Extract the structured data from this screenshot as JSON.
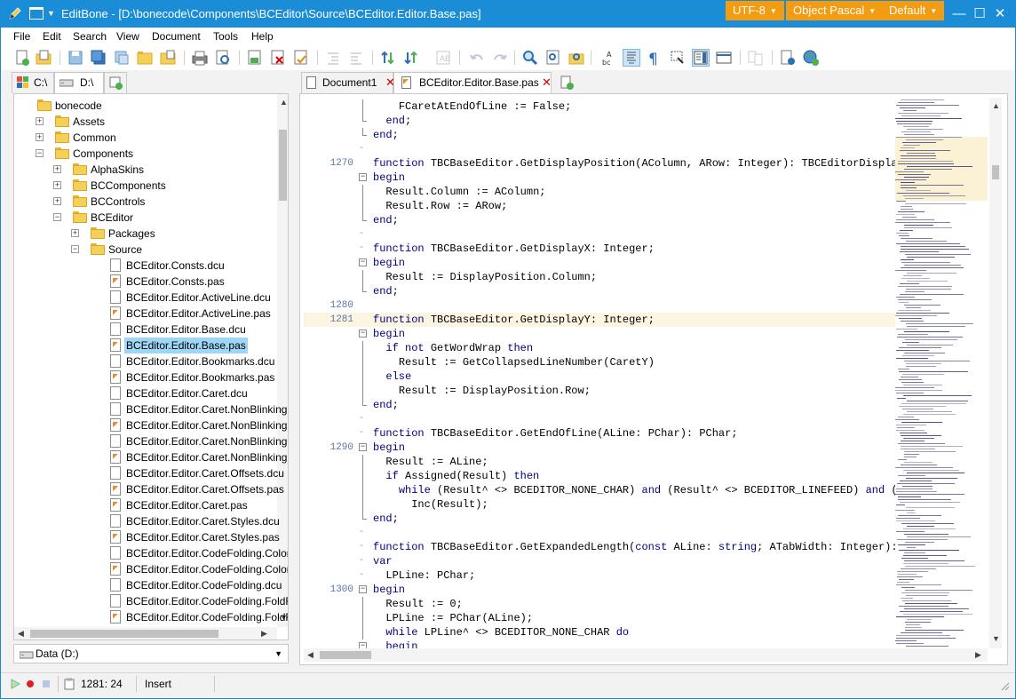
{
  "window": {
    "title": "EditBone - [D:\\bonecode\\Components\\BCEditor\\Source\\BCEditor.Editor.Base.pas]",
    "encoding": "UTF-8",
    "highlighter": "Object Pascal",
    "color_scheme": "Default",
    "accent_color": "#1b8dd6",
    "button_color": "#f39c12"
  },
  "menu": [
    "File",
    "Edit",
    "Search",
    "View",
    "Document",
    "Tools",
    "Help"
  ],
  "toolbar": {
    "icons": [
      "new-file-icon",
      "open-file-icon",
      "save-icon",
      "save-all-icon",
      "save-as-icon",
      "open-folder-icon",
      "close-icon",
      "print-icon",
      "print-preview-icon",
      "close-document-icon",
      "close-all-icon",
      "close-all-other-icon",
      "indent-icon",
      "outdent-icon",
      "sort-icon",
      "undo-icon",
      "redo-icon",
      "search-icon",
      "search-replace-icon",
      "sort-ascending-icon",
      "sort-descending-icon",
      "case-icon",
      "word-wrap-icon",
      "special-chars-icon",
      "selection-mode-icon",
      "minimap-icon",
      "ruler-icon",
      "compare-icon",
      "settings-icon",
      "web-icon"
    ]
  },
  "left_panel": {
    "tabs": [
      {
        "label": "C:\\",
        "icon": "windows-drive-icon"
      },
      {
        "label": "D:\\",
        "icon": "drive-icon"
      },
      {
        "label": "",
        "icon": "new-tab-icon"
      }
    ],
    "tree": [
      {
        "label": "bonecode",
        "level": 0,
        "type": "folder",
        "expander": "none"
      },
      {
        "label": "Assets",
        "level": 1,
        "type": "folder",
        "expander": "+"
      },
      {
        "label": "Common",
        "level": 1,
        "type": "folder",
        "expander": "+"
      },
      {
        "label": "Components",
        "level": 1,
        "type": "folder",
        "expander": "-"
      },
      {
        "label": "AlphaSkins",
        "level": 2,
        "type": "folder",
        "expander": "+"
      },
      {
        "label": "BCComponents",
        "level": 2,
        "type": "folder",
        "expander": "+"
      },
      {
        "label": "BCControls",
        "level": 2,
        "type": "folder",
        "expander": "+"
      },
      {
        "label": "BCEditor",
        "level": 2,
        "type": "folder",
        "expander": "-"
      },
      {
        "label": "Packages",
        "level": 3,
        "type": "folder",
        "expander": "+"
      },
      {
        "label": "Source",
        "level": 3,
        "type": "folder",
        "expander": "-"
      },
      {
        "label": "BCEditor.Consts.dcu",
        "level": 4,
        "type": "dcu"
      },
      {
        "label": "BCEditor.Consts.pas",
        "level": 4,
        "type": "pas"
      },
      {
        "label": "BCEditor.Editor.ActiveLine.dcu",
        "level": 4,
        "type": "dcu"
      },
      {
        "label": "BCEditor.Editor.ActiveLine.pas",
        "level": 4,
        "type": "pas"
      },
      {
        "label": "BCEditor.Editor.Base.dcu",
        "level": 4,
        "type": "dcu"
      },
      {
        "label": "BCEditor.Editor.Base.pas",
        "level": 4,
        "type": "pas",
        "selected": true
      },
      {
        "label": "BCEditor.Editor.Bookmarks.dcu",
        "level": 4,
        "type": "dcu"
      },
      {
        "label": "BCEditor.Editor.Bookmarks.pas",
        "level": 4,
        "type": "pas"
      },
      {
        "label": "BCEditor.Editor.Caret.dcu",
        "level": 4,
        "type": "dcu"
      },
      {
        "label": "BCEditor.Editor.Caret.NonBlinking.",
        "level": 4,
        "type": "dcu"
      },
      {
        "label": "BCEditor.Editor.Caret.NonBlinking.",
        "level": 4,
        "type": "pas"
      },
      {
        "label": "BCEditor.Editor.Caret.NonBlinking.",
        "level": 4,
        "type": "dcu"
      },
      {
        "label": "BCEditor.Editor.Caret.NonBlinking.",
        "level": 4,
        "type": "pas"
      },
      {
        "label": "BCEditor.Editor.Caret.Offsets.dcu",
        "level": 4,
        "type": "dcu"
      },
      {
        "label": "BCEditor.Editor.Caret.Offsets.pas",
        "level": 4,
        "type": "pas"
      },
      {
        "label": "BCEditor.Editor.Caret.pas",
        "level": 4,
        "type": "pas"
      },
      {
        "label": "BCEditor.Editor.Caret.Styles.dcu",
        "level": 4,
        "type": "dcu"
      },
      {
        "label": "BCEditor.Editor.Caret.Styles.pas",
        "level": 4,
        "type": "pas"
      },
      {
        "label": "BCEditor.Editor.CodeFolding.Color",
        "level": 4,
        "type": "dcu"
      },
      {
        "label": "BCEditor.Editor.CodeFolding.Color",
        "level": 4,
        "type": "pas"
      },
      {
        "label": "BCEditor.Editor.CodeFolding.dcu",
        "level": 4,
        "type": "dcu"
      },
      {
        "label": "BCEditor.Editor.CodeFolding.FoldR",
        "level": 4,
        "type": "dcu"
      },
      {
        "label": "BCEditor.Editor.CodeFolding.FoldR",
        "level": 4,
        "type": "pas"
      }
    ],
    "drive_combo": "Data (D:)"
  },
  "editor": {
    "tabs": [
      {
        "label": "Document1",
        "active": false
      },
      {
        "label": "BCEditor.Editor.Base.pas",
        "active": true
      }
    ],
    "lines": [
      {
        "num": "",
        "mark": "-",
        "fold": "line",
        "text": "    FCaretAtEndOfLine := False;"
      },
      {
        "num": "",
        "mark": "-",
        "fold": "end",
        "text": "  end;"
      },
      {
        "num": "",
        "mark": "-",
        "fold": "end",
        "text": "end;"
      },
      {
        "num": "",
        "mark": "-",
        "fold": "",
        "text": ""
      },
      {
        "num": "1270",
        "mark": "",
        "fold": "",
        "text": "function TBCBaseEditor.GetDisplayPosition(AColumn, ARow: Integer): TBCEditorDisplayP"
      },
      {
        "num": "",
        "mark": "",
        "fold": "box",
        "text": "begin"
      },
      {
        "num": "",
        "mark": "-",
        "fold": "line",
        "text": "  Result.Column := AColumn;"
      },
      {
        "num": "",
        "mark": "-",
        "fold": "line",
        "text": "  Result.Row := ARow;"
      },
      {
        "num": "",
        "mark": "-",
        "fold": "end",
        "text": "end;"
      },
      {
        "num": "",
        "mark": "-",
        "fold": "",
        "text": ""
      },
      {
        "num": "",
        "mark": "-",
        "fold": "",
        "text": "function TBCBaseEditor.GetDisplayX: Integer;"
      },
      {
        "num": "",
        "mark": "",
        "fold": "box",
        "text": "begin"
      },
      {
        "num": "",
        "mark": "-",
        "fold": "line",
        "text": "  Result := DisplayPosition.Column;"
      },
      {
        "num": "",
        "mark": "-",
        "fold": "end",
        "text": "end;"
      },
      {
        "num": "1280",
        "mark": "",
        "fold": "",
        "text": ""
      },
      {
        "num": "1281",
        "mark": "",
        "fold": "",
        "text": "function TBCBaseEditor.GetDisplayY: Integer;",
        "active": true
      },
      {
        "num": "",
        "mark": "",
        "fold": "box",
        "text": "begin"
      },
      {
        "num": "",
        "mark": "-",
        "fold": "line",
        "text": "  if not GetWordWrap then"
      },
      {
        "num": "",
        "mark": "-",
        "fold": "line",
        "text": "    Result := GetCollapsedLineNumber(CaretY)"
      },
      {
        "num": "",
        "mark": "–",
        "fold": "line",
        "text": "  else"
      },
      {
        "num": "",
        "mark": "-",
        "fold": "line",
        "text": "    Result := DisplayPosition.Row;"
      },
      {
        "num": "",
        "mark": "-",
        "fold": "end",
        "text": "end;"
      },
      {
        "num": "",
        "mark": "-",
        "fold": "",
        "text": ""
      },
      {
        "num": "",
        "mark": "-",
        "fold": "",
        "text": "function TBCBaseEditor.GetEndOfLine(ALine: PChar): PChar;"
      },
      {
        "num": "1290",
        "mark": "",
        "fold": "box",
        "text": "begin"
      },
      {
        "num": "",
        "mark": "-",
        "fold": "line",
        "text": "  Result := ALine;"
      },
      {
        "num": "",
        "mark": "-",
        "fold": "line",
        "text": "  if Assigned(Result) then"
      },
      {
        "num": "",
        "mark": "-",
        "fold": "line",
        "text": "    while (Result^ <> BCEDITOR_NONE_CHAR) and (Result^ <> BCEDITOR_LINEFEED) and (Re"
      },
      {
        "num": "",
        "mark": "-",
        "fold": "line",
        "text": "      Inc(Result);"
      },
      {
        "num": "",
        "mark": "-",
        "fold": "end",
        "text": "end;"
      },
      {
        "num": "",
        "mark": "-",
        "fold": "",
        "text": ""
      },
      {
        "num": "",
        "mark": "-",
        "fold": "",
        "text": "function TBCBaseEditor.GetExpandedLength(const ALine: string; ATabWidth: Integer): I"
      },
      {
        "num": "",
        "mark": "-",
        "fold": "",
        "text": "var"
      },
      {
        "num": "",
        "mark": "-",
        "fold": "",
        "text": "  LPLine: PChar;"
      },
      {
        "num": "1300",
        "mark": "",
        "fold": "box",
        "text": "begin"
      },
      {
        "num": "",
        "mark": "-",
        "fold": "line",
        "text": "  Result := 0;"
      },
      {
        "num": "",
        "mark": "-",
        "fold": "line",
        "text": "  LPLine := PChar(ALine);"
      },
      {
        "num": "",
        "mark": "-",
        "fold": "line",
        "text": "  while LPLine^ <> BCEDITOR_NONE_CHAR do"
      },
      {
        "num": "",
        "mark": "-",
        "fold": "box",
        "text": "  begin"
      }
    ],
    "keywords": [
      "function",
      "begin",
      "end",
      "if",
      "not",
      "then",
      "else",
      "while",
      "and",
      "var",
      "do",
      "const",
      "string"
    ]
  },
  "status": {
    "position": "1281: 24",
    "mode": "Insert"
  }
}
